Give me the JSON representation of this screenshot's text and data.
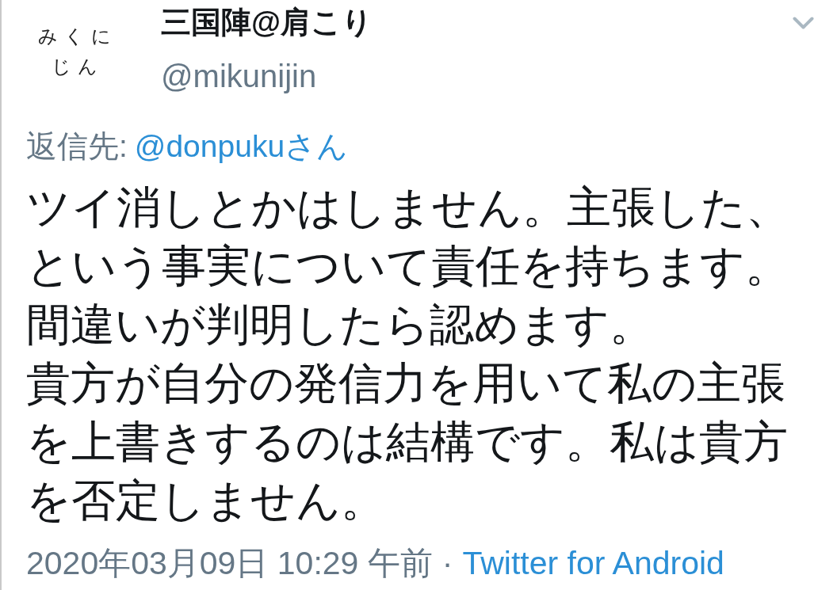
{
  "avatar": {
    "lines": [
      "みくに",
      "じん"
    ]
  },
  "author": {
    "name": "三国陣@肩こり",
    "handle": "@mikunijin"
  },
  "reply_to": {
    "label": "返信先:",
    "user": "@donpukuさん"
  },
  "paragraphs": [
    "ツイ消しとかはしません。主張した、という事実について責任を持ちます。",
    "間違いが判明したら認めます。",
    "貴方が自分の発信力を用いて私の主張を上書きするのは結構です。私は貴方を否定しません。"
  ],
  "footer": {
    "timestamp": "2020年03月09日 10:29 午前",
    "separator": "·",
    "source": "Twitter for Android"
  }
}
